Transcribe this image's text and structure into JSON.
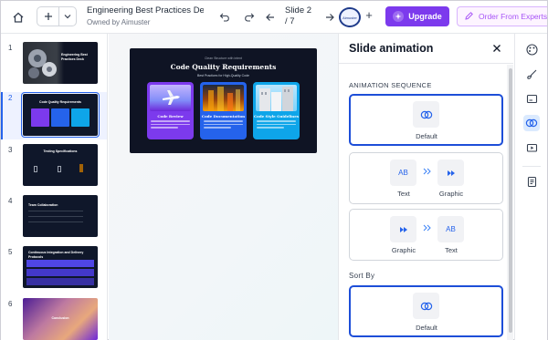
{
  "header": {
    "doc_title": "Engineering Best Practices De...",
    "doc_owner": "Owned by Aimuster",
    "slide_label": "Slide 2",
    "slide_total": "/ 7",
    "avatar_text": "Aimuster",
    "add_collaborator": "+",
    "upgrade_label": "Upgrade",
    "expert_label": "Order From Experts"
  },
  "slides": [
    {
      "num": "1",
      "title": "Engineering Best Practices Deck"
    },
    {
      "num": "2",
      "title": "Code Quality Requirements"
    },
    {
      "num": "3",
      "title": "Testing Specifications"
    },
    {
      "num": "4",
      "title": "Team Collaboration"
    },
    {
      "num": "5",
      "title": "Continuous Integration and Delivery Protocols"
    },
    {
      "num": "6",
      "title": "Conclusion"
    }
  ],
  "main_slide": {
    "kicker": "Clean Structure with intent",
    "title": "Code Quality Requirements",
    "subtitle": "Best Practices for High-Quality Code",
    "cards": [
      {
        "title": "Code Review",
        "color": "#7c3aed"
      },
      {
        "title": "Code Documentation",
        "color": "#2563eb"
      },
      {
        "title": "Code Style Guidelines",
        "color": "#0ea5e9"
      }
    ]
  },
  "panel": {
    "title": "Slide animation",
    "sequence_label": "ANIMATION SEQUENCE",
    "sort_label": "Sort By",
    "options": [
      {
        "id": "default",
        "label": "Default"
      },
      {
        "id": "text-graphic",
        "first_tile": "AB",
        "first": "Text",
        "second": "Graphic"
      },
      {
        "id": "graphic-text",
        "second_tile": "AB",
        "first": "Graphic",
        "second": "Text"
      }
    ],
    "sort_option": {
      "label": "Default"
    }
  },
  "colors": {
    "accent": "#2563eb",
    "upgrade": "#7c3aed",
    "expert": "#a855f7"
  }
}
